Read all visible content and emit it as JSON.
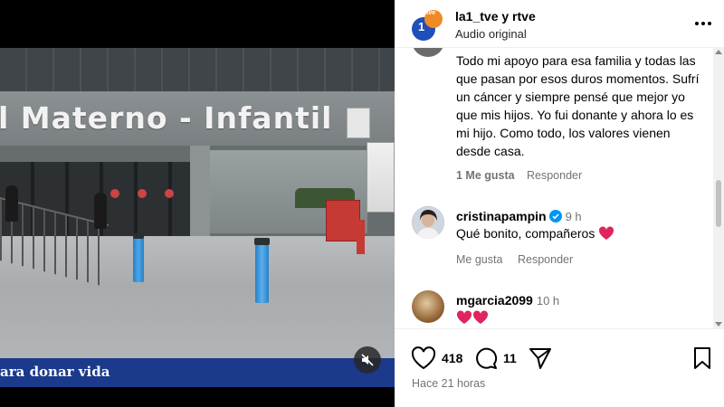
{
  "video": {
    "sign_text": "l Materno - Infantil",
    "caption": "ara donar vida"
  },
  "post": {
    "account": "la1_tve y rtve",
    "subtitle": "Audio original",
    "logo_text": "1",
    "logo_small_text": "tve"
  },
  "comments": [
    {
      "text": "Todo mi apoyo para esa familia y todas las que pasan por esos duros momentos. Sufrí un cáncer y siempre pensé que mejor yo que mis hijos. Yo fui donante y ahora lo es mi hijo. Como todo, los valores vienen desde casa.",
      "likes": "1 Me gusta",
      "reply": "Responder"
    },
    {
      "user": "cristinapampin",
      "time": "9 h",
      "text": "Qué bonito, compañeros",
      "likes": "Me gusta",
      "reply": "Responder"
    },
    {
      "user": "mgarcia2099",
      "time": "10 h"
    }
  ],
  "actions": {
    "likes": "418",
    "comments": "11"
  },
  "timestamp": "Hace 21 horas",
  "colors": {
    "caption_bar": "#1b3a8c",
    "verified": "#0095f6",
    "heart": "#e0245e",
    "muted_text": "#737373"
  }
}
